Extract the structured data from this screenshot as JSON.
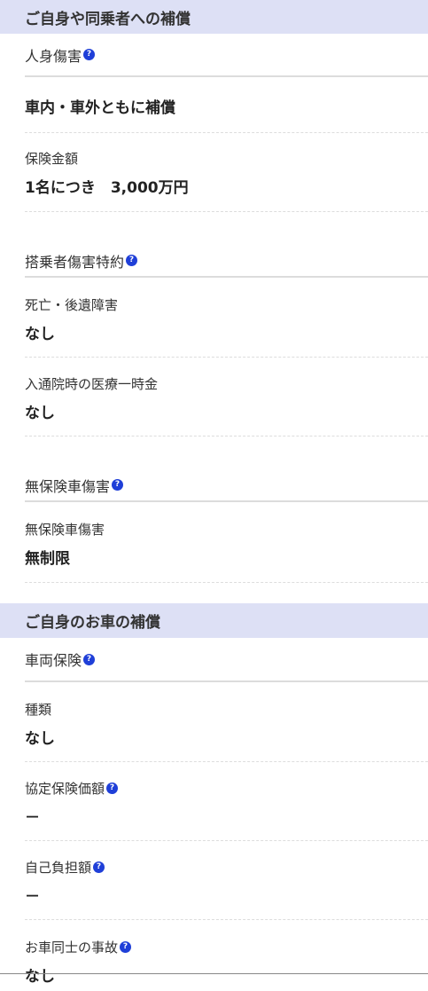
{
  "section1": {
    "title": "ご自身や同乗者への補償",
    "personal_injury": {
      "title": "人身傷害",
      "coverage_value": "車内・車外ともに補償",
      "amount_label": "保険金額",
      "amount_value": "1名につき　3,000万円"
    },
    "passenger_injury": {
      "title": "搭乗者傷害特約",
      "death_label": "死亡・後遺障害",
      "death_value": "なし",
      "medical_label": "入通院時の医療一時金",
      "medical_value": "なし"
    },
    "uninsured_vehicle": {
      "title": "無保険車傷害",
      "label": "無保険車傷害",
      "value": "無制限"
    }
  },
  "section2": {
    "title": "ご自身のお車の補償",
    "vehicle_insurance": {
      "title": "車両保険",
      "type_label": "種類",
      "type_value": "なし",
      "agreed_value_label": "協定保険価額",
      "agreed_value_value": "－",
      "deductible_label": "自己負担額",
      "deductible_value": "－",
      "car_to_car_label": "お車同士の事故",
      "car_to_car_value": "なし"
    }
  },
  "help_icon_glyph": "?",
  "colors": {
    "section_header_bg": "#dde0f5",
    "help_icon": "#1f3fd8"
  }
}
